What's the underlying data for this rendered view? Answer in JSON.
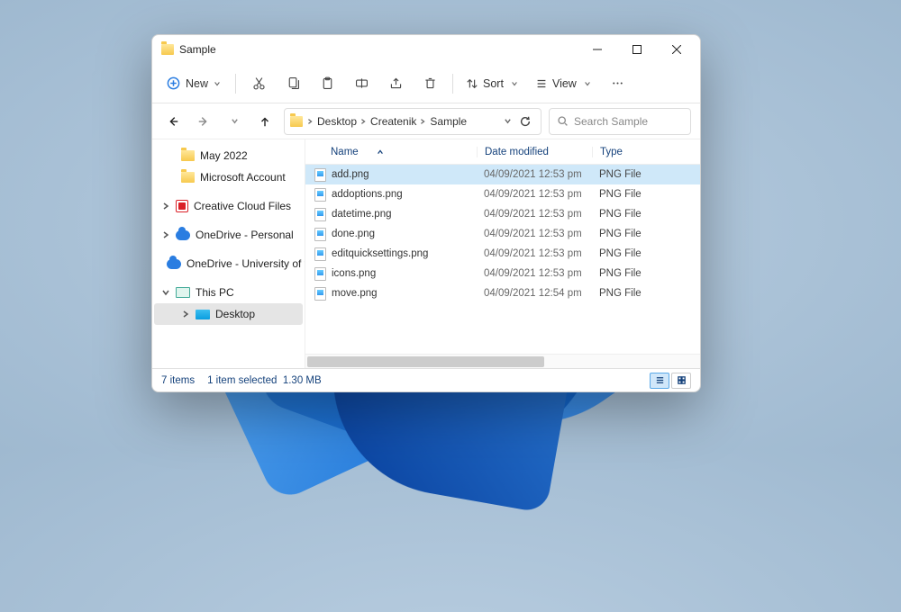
{
  "window": {
    "title": "Sample"
  },
  "toolbar": {
    "new_label": "New",
    "sort_label": "Sort",
    "view_label": "View"
  },
  "breadcrumb": {
    "items": [
      "Desktop",
      "Createnik",
      "Sample"
    ]
  },
  "search": {
    "placeholder": "Search Sample"
  },
  "sidebar": {
    "may2022": "May 2022",
    "msaccount": "Microsoft Account",
    "cc": "Creative Cloud Files",
    "od_personal": "OneDrive - Personal",
    "od_uni": "OneDrive - University of t",
    "this_pc": "This PC",
    "desktop": "Desktop"
  },
  "columns": {
    "name": "Name",
    "date": "Date modified",
    "type": "Type"
  },
  "files": [
    {
      "name": "add.png",
      "date": "04/09/2021 12:53 pm",
      "type": "PNG File",
      "selected": true
    },
    {
      "name": "addoptions.png",
      "date": "04/09/2021 12:53 pm",
      "type": "PNG File",
      "selected": false
    },
    {
      "name": "datetime.png",
      "date": "04/09/2021 12:53 pm",
      "type": "PNG File",
      "selected": false
    },
    {
      "name": "done.png",
      "date": "04/09/2021 12:53 pm",
      "type": "PNG File",
      "selected": false
    },
    {
      "name": "editquicksettings.png",
      "date": "04/09/2021 12:53 pm",
      "type": "PNG File",
      "selected": false
    },
    {
      "name": "icons.png",
      "date": "04/09/2021 12:53 pm",
      "type": "PNG File",
      "selected": false
    },
    {
      "name": "move.png",
      "date": "04/09/2021 12:54 pm",
      "type": "PNG File",
      "selected": false
    }
  ],
  "status": {
    "count": "7 items",
    "selected": "1 item selected",
    "size": "1.30 MB"
  }
}
